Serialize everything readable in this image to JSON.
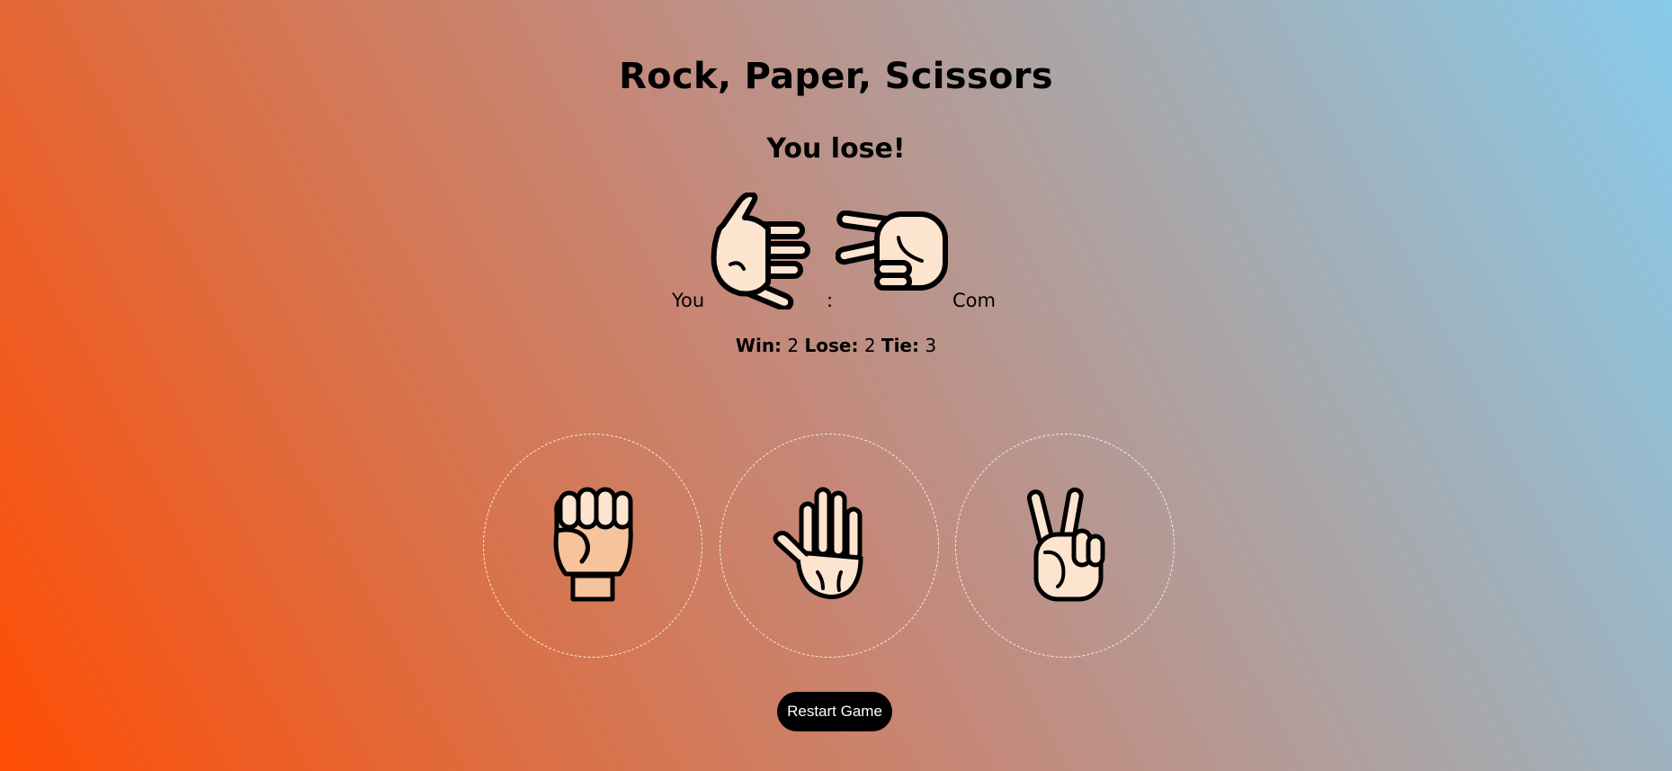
{
  "game": {
    "title": "Rock, Paper, Scissors",
    "result": "You lose!",
    "you_label": "You",
    "separator": ":",
    "com_label": "Com",
    "player_choice": "paper",
    "computer_choice": "scissors"
  },
  "score": {
    "win_label": "Win:",
    "win": "2",
    "lose_label": "Lose:",
    "lose": "2",
    "tie_label": "Tie:",
    "tie": "3"
  },
  "choices": [
    {
      "id": "rock",
      "icon": "rock-hand-icon"
    },
    {
      "id": "paper",
      "icon": "paper-hand-icon"
    },
    {
      "id": "scissors",
      "icon": "scissors-hand-icon"
    }
  ],
  "restart_label": "Restart Game",
  "colors": {
    "skin_light": "#fde4cf",
    "skin_dark": "#f7c39b",
    "outline": "#000000",
    "button_bg": "#000000",
    "button_text": "#ffffff",
    "bg_start": "#ff4d05",
    "bg_end": "#88cbeb"
  }
}
